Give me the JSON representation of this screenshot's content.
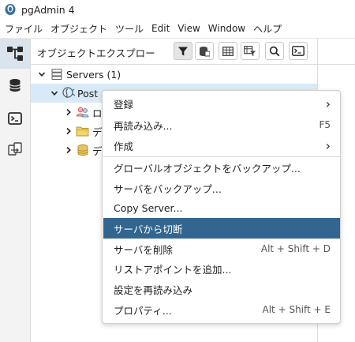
{
  "app": {
    "title": "pgAdmin 4"
  },
  "menu": {
    "items": [
      "ファイル",
      "オブジェクト",
      "ツール",
      "Edit",
      "View",
      "Window",
      "ヘルプ"
    ]
  },
  "panel": {
    "title": "オブジェクトエクスプロー"
  },
  "tree": {
    "servers_label": "Servers (1)",
    "server_label": "Post",
    "child1_label": "ロ",
    "child2_label": "デ",
    "child3_label": "デ"
  },
  "context_menu": {
    "items": [
      {
        "label": "登録",
        "submenu": true
      },
      {
        "label": "再読み込み...",
        "shortcut": "F5"
      },
      {
        "label": "作成",
        "submenu": true
      },
      {
        "label": "グローバルオブジェクトをバックアップ..."
      },
      {
        "label": "サーバをバックアップ..."
      },
      {
        "label": "Copy Server..."
      },
      {
        "label": "サーバから切断",
        "highlighted": true
      },
      {
        "label": "サーバを削除",
        "shortcut": "Alt + Shift + D"
      },
      {
        "label": "リストアポイントを追加..."
      },
      {
        "label": "設定を再読み込み"
      },
      {
        "label": "プロパティ...",
        "shortcut": "Alt + Shift + E"
      }
    ],
    "submenu_arrow": "›"
  },
  "colors": {
    "highlight": "#326690",
    "selected_row": "#d8eaf7",
    "sidebar_active": "#dbe3ec"
  }
}
